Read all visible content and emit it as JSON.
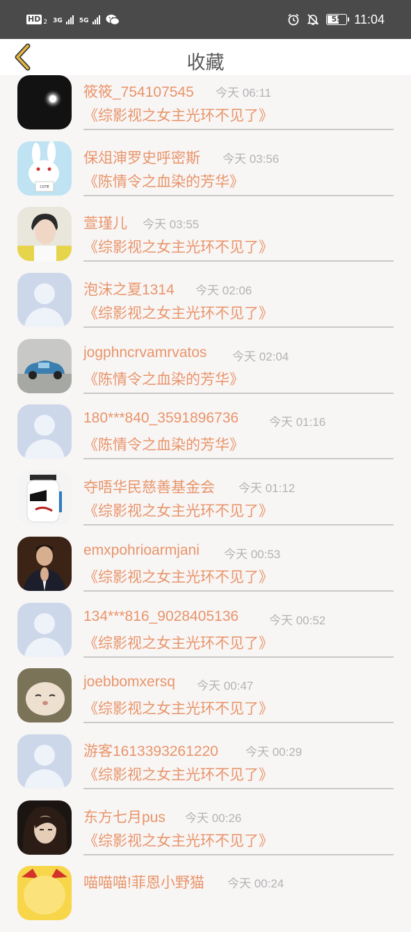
{
  "status_bar": {
    "hd_label": "HD",
    "hd_sub": "2",
    "net1": "3G",
    "net2": "5G",
    "battery": "55",
    "time": "11:04",
    "icons": [
      "alarm-icon",
      "mute-icon",
      "battery-icon",
      "wechat-icon"
    ]
  },
  "header": {
    "title": "收藏",
    "back_icon": "chevron-left-icon"
  },
  "items": [
    {
      "name": "筱筱_754107545",
      "time": "今天 06:11",
      "book": "《综影视之女主光环不见了》",
      "avatar": "moon-photo"
    },
    {
      "name": "保俎渖罗史呼密斯",
      "time": "今天 03:56",
      "book": "《陈情令之血染的芳华》",
      "avatar": "white-rabbit"
    },
    {
      "name": "萱瑾儿",
      "time": "今天 03:55",
      "book": "《综影视之女主光环不见了》",
      "avatar": "young-man-photo"
    },
    {
      "name": "泡沫之夏1314",
      "time": "今天 02:06",
      "book": "《综影视之女主光环不见了》",
      "avatar": "default"
    },
    {
      "name": "jogphncrvamrvatos",
      "time": "今天 02:04",
      "book": "《陈情令之血染的芳华》",
      "avatar": "toy-car"
    },
    {
      "name": "180***840_3591896736",
      "time": "今天 01:16",
      "book": "《陈情令之血染的芳华》",
      "avatar": "default"
    },
    {
      "name": "夺唔华民慈善基金会",
      "time": "今天 01:12",
      "book": "《综影视之女主光环不见了》",
      "avatar": "jar-doll"
    },
    {
      "name": "emxpohrioarmjani",
      "time": "今天 00:53",
      "book": "《综影视之女主光环不见了》",
      "avatar": "suit-man"
    },
    {
      "name": "134***816_9028405136",
      "time": "今天 00:52",
      "book": "《综影视之女主光环不见了》",
      "avatar": "default"
    },
    {
      "name": "joebbomxersq",
      "time": "今天 00:47",
      "book": "《综影视之女主光环不见了》",
      "avatar": "sleeping-cat"
    },
    {
      "name": "游客1613393261220",
      "time": "今天 00:29",
      "book": "《综影视之女主光环不见了》",
      "avatar": "default"
    },
    {
      "name": "东方七月pus",
      "time": "今天 00:26",
      "book": "《综影视之女主光环不见了》",
      "avatar": "anime-girl"
    },
    {
      "name": "喵喵喵!菲恩小野猫",
      "time": "今天 00:24",
      "book": "",
      "avatar": "cartoon-yellow"
    }
  ],
  "colors": {
    "accent": "#e8956a",
    "time_gray": "#b3b3b3",
    "title_gray": "#595959",
    "back_yellow": "#e7b640"
  }
}
